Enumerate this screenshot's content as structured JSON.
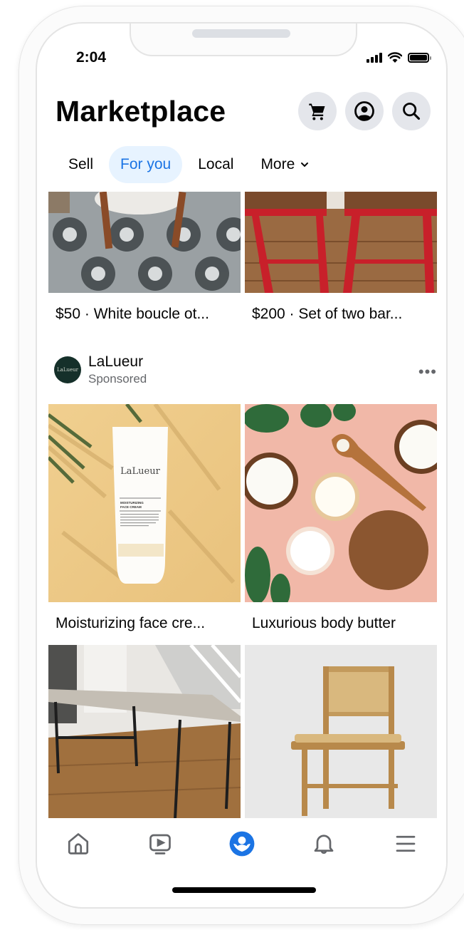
{
  "status_bar": {
    "time": "2:04"
  },
  "header": {
    "title": "Marketplace",
    "actions": [
      {
        "name": "cart-icon"
      },
      {
        "name": "profile-icon"
      },
      {
        "name": "search-icon"
      }
    ]
  },
  "tabs": [
    {
      "label": "Sell",
      "active": false
    },
    {
      "label": "For you",
      "active": true
    },
    {
      "label": "Local",
      "active": false
    },
    {
      "label": "More",
      "active": false,
      "has_dropdown": true
    }
  ],
  "listings_top": [
    {
      "price": "$50",
      "title": "White boucle ot...",
      "caption": "$50 · White boucle ot..."
    },
    {
      "price": "$200",
      "title": "Set of two bar...",
      "caption": "$200 · Set of two bar..."
    }
  ],
  "sponsored": {
    "advertiser": "LaLueur",
    "avatar_text": "LaLueur",
    "label": "Sponsored",
    "more_icon": "more-horizontal-icon",
    "items": [
      {
        "caption": "Moisturizing face cre...",
        "product_brand": "LaLueur",
        "product_name": "MOISTURIZING FACE CREAM"
      },
      {
        "caption": "Luxurious body butter"
      }
    ]
  },
  "bottom_nav": {
    "active": "marketplace",
    "items": [
      {
        "name": "home"
      },
      {
        "name": "video"
      },
      {
        "name": "marketplace"
      },
      {
        "name": "notifications"
      },
      {
        "name": "menu"
      }
    ]
  },
  "colors": {
    "accent": "#1b74e4",
    "accent_bg": "#e7f3ff",
    "secondary_text": "#65676b",
    "button_bg": "#e4e6eb"
  }
}
